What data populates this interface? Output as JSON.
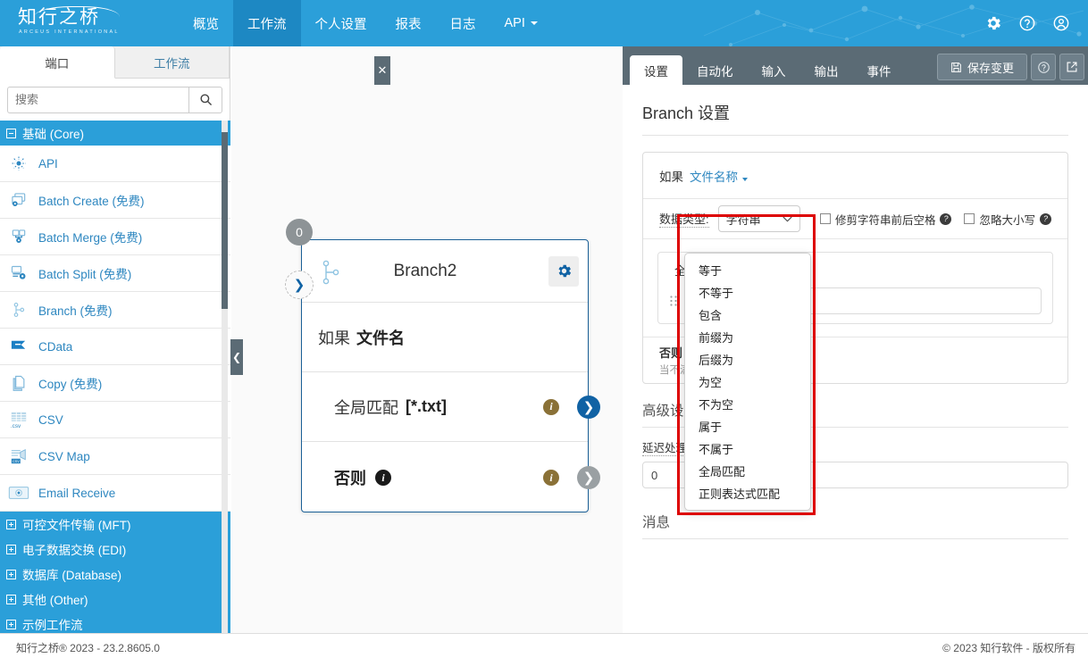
{
  "topbar": {
    "logo_cn": "知行之桥",
    "logo_en": "ARCEUS INTERNATIONAL",
    "nav": [
      {
        "label": "概览",
        "active": false
      },
      {
        "label": "工作流",
        "active": true
      },
      {
        "label": "个人设置",
        "active": false
      },
      {
        "label": "报表",
        "active": false
      },
      {
        "label": "日志",
        "active": false
      },
      {
        "label": "API",
        "active": false,
        "caret": true
      }
    ],
    "icons": [
      "gear-icon",
      "help-icon",
      "user-icon"
    ],
    "bg_color": "#2b9fd9",
    "active_color": "#1d88c3"
  },
  "sidebar": {
    "tabs": [
      {
        "label": "端口",
        "active": true
      },
      {
        "label": "工作流",
        "active": false
      }
    ],
    "search_placeholder": "搜索",
    "search_value": "",
    "search_icon": "search-icon",
    "groups": [
      {
        "label": "基础 (Core)",
        "expanded": true
      },
      {
        "label": "可控文件传输 (MFT)",
        "expanded": false
      },
      {
        "label": "电子数据交换 (EDI)",
        "expanded": false
      },
      {
        "label": "数据库 (Database)",
        "expanded": false
      },
      {
        "label": "其他 (Other)",
        "expanded": false
      },
      {
        "label": "示例工作流",
        "expanded": false
      }
    ],
    "items": [
      {
        "label": "API",
        "icon": "api-icon"
      },
      {
        "label": "Batch Create (免费)",
        "icon": "batch-create-icon"
      },
      {
        "label": "Batch Merge (免费)",
        "icon": "batch-merge-icon"
      },
      {
        "label": "Batch Split (免费)",
        "icon": "batch-split-icon"
      },
      {
        "label": "Branch (免费)",
        "icon": "branch-icon"
      },
      {
        "label": "CData",
        "icon": "cdata-icon"
      },
      {
        "label": "Copy (免费)",
        "icon": "copy-icon"
      },
      {
        "label": "CSV",
        "icon": "csv-icon"
      },
      {
        "label": "CSV Map",
        "icon": "csv-map-icon"
      },
      {
        "label": "Email Receive",
        "icon": "email-receive-icon"
      }
    ],
    "collapse_icon": "chevron-left-icon"
  },
  "canvas": {
    "close_label": "✕",
    "node": {
      "badge": "0",
      "title": "Branch2",
      "gear_icon": "gear-icon",
      "branch_icon": "branch-icon",
      "rows": [
        {
          "prefix": "如果",
          "value": "文件名",
          "type": "if"
        },
        {
          "prefix": "全局匹配",
          "value": "[*.txt]",
          "type": "match",
          "arrow": "blue"
        },
        {
          "prefix": "否则",
          "value": "",
          "type": "else",
          "arrow": "gray"
        }
      ]
    }
  },
  "panel": {
    "tabs": [
      {
        "label": "设置",
        "active": true
      },
      {
        "label": "自动化",
        "active": false
      },
      {
        "label": "输入",
        "active": false
      },
      {
        "label": "输出",
        "active": false
      },
      {
        "label": "事件",
        "active": false
      }
    ],
    "save_label": "保存变更",
    "save_icon": "save-icon",
    "help_icon": "help-icon",
    "popout_icon": "external-link-icon",
    "title": "Branch 设置",
    "condition": {
      "if_label": "如果",
      "field_label": "文件名称",
      "datatype_label": "数据类型:",
      "datatype_value": "字符串",
      "checkboxes": [
        {
          "label": "修剪字符串前后空格",
          "checked": false
        },
        {
          "label": "忽略大小写",
          "checked": false
        }
      ],
      "operator_value": "全局匹配",
      "value_input": "",
      "drag_handle_icon": "drag-handle-icon"
    },
    "else": {
      "title": "否则",
      "subtitle": "当不满"
    },
    "dropdown": {
      "options": [
        "等于",
        "不等于",
        "包含",
        "前缀为",
        "后缀为",
        "为空",
        "不为空",
        "属于",
        "不属于",
        "全局匹配",
        "正则表达式匹配"
      ],
      "highlight_color": "#dd0000"
    },
    "advanced": {
      "title": "高级设置",
      "delay_label": "延迟处理",
      "delay_value": "0"
    },
    "messages": {
      "title": "消息"
    }
  },
  "footer": {
    "left": "知行之桥® 2023 - 23.2.8605.0",
    "right": "© 2023 知行软件 - 版权所有"
  }
}
